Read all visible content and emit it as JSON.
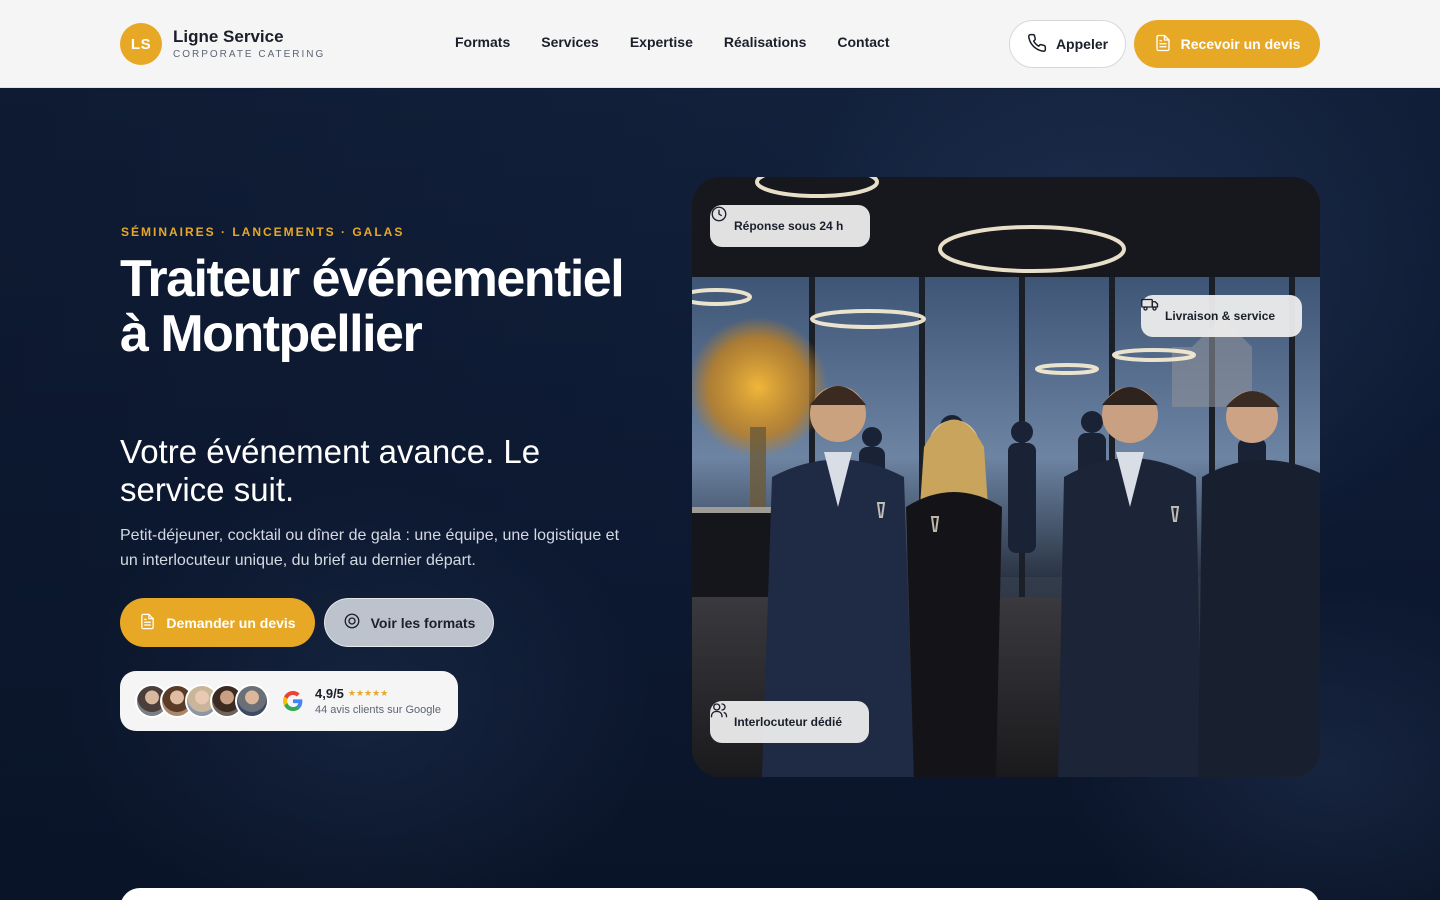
{
  "brand": {
    "initials": "LS",
    "name": "Ligne Service",
    "tagline": "CORPORATE CATERING"
  },
  "nav": {
    "items": [
      {
        "label": "Formats"
      },
      {
        "label": "Services"
      },
      {
        "label": "Expertise"
      },
      {
        "label": "Réalisations"
      },
      {
        "label": "Contact"
      }
    ]
  },
  "header_actions": {
    "call_label": "Appeler",
    "quote_label": "Recevoir un devis"
  },
  "hero": {
    "eyebrow": "SÉMINAIRES · LANCEMENTS · GALAS",
    "title": "Traiteur événementiel à Montpellier",
    "subtitle": "Votre événement avance. Le service suit.",
    "description": "Petit-déjeuner, cocktail ou dîner de gala : une équipe, une logistique et un interlocuteur unique, du brief au dernier départ.",
    "primary_cta": "Demander un devis",
    "secondary_cta": "Voir les formats"
  },
  "reviews": {
    "score": "4,9/5",
    "stars": "★★★★★",
    "rating_value": 4.9,
    "rating_max": 5,
    "summary": "44 avis clients sur Google"
  },
  "photo_chips": {
    "response": "Réponse sous 24 h",
    "delivery": "Livraison & service",
    "contact": "Interlocuteur dédié"
  },
  "colors": {
    "accent": "#e7a925",
    "navy": "#0d1a33",
    "header_bg": "#f5f5f5",
    "text_dark": "#1b1f2a"
  },
  "icons": [
    "phone-icon",
    "document-icon",
    "target-icon",
    "google-icon",
    "clock-icon",
    "truck-icon",
    "users-icon"
  ]
}
